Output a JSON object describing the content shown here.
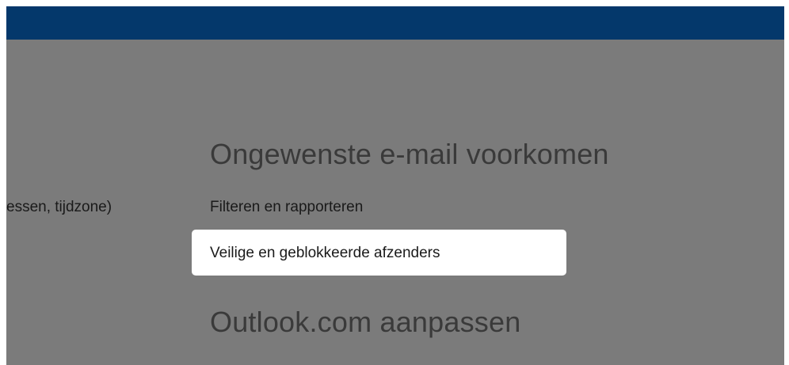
{
  "header": {
    "color": "#04386b"
  },
  "left_column": {
    "partial_item": "essen, tijdzone)"
  },
  "sections": [
    {
      "title": "Ongewenste e-mail voorkomen",
      "items": [
        {
          "label": "Filteren en rapporteren"
        },
        {
          "label": "Veilige en geblokkeerde afzenders",
          "highlighted": true
        }
      ]
    },
    {
      "title": "Outlook.com aanpassen"
    }
  ],
  "colors": {
    "overlay": "#7b7b7b",
    "highlight": "#ffffff"
  }
}
